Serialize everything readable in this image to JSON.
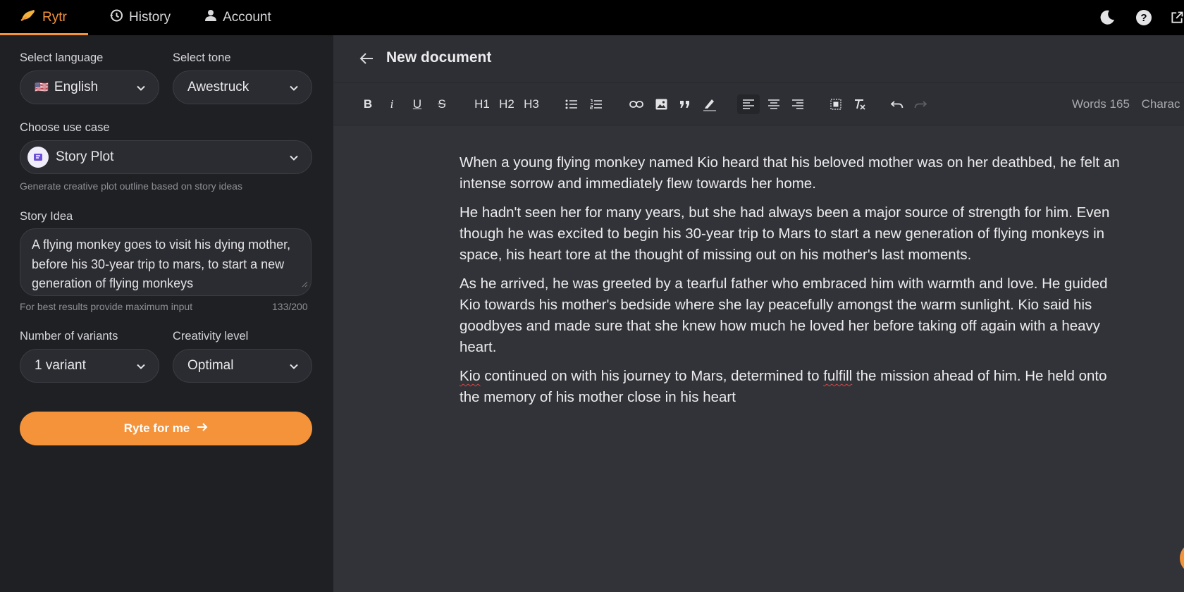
{
  "nav": {
    "brand": "Rytr",
    "tabs": [
      {
        "label": "History",
        "icon": "history-icon"
      },
      {
        "label": "Account",
        "icon": "account-icon"
      }
    ],
    "right_icons": [
      "moon-icon",
      "help-icon",
      "external-link-icon"
    ]
  },
  "sidebar": {
    "language": {
      "label": "Select language",
      "value": "English",
      "flag": "🇺🇸"
    },
    "tone": {
      "label": "Select tone",
      "value": "Awestruck"
    },
    "use_case": {
      "label": "Choose use case",
      "value": "Story Plot",
      "hint": "Generate creative plot outline based on story ideas"
    },
    "story_idea": {
      "label": "Story Idea",
      "value": "A flying monkey goes to visit his dying mother, before his 30-year trip to mars, to start a new generation of flying monkeys",
      "hint": "For best results provide maximum input",
      "count": "133/200"
    },
    "variants": {
      "label": "Number of variants",
      "value": "1 variant"
    },
    "creativity": {
      "label": "Creativity level",
      "value": "Optimal"
    },
    "button": "Ryte for me"
  },
  "document": {
    "title": "New document",
    "words": "Words 165",
    "characters": "Charac",
    "toolbar": {
      "bold": "B",
      "italic": "i",
      "underline": "U",
      "strike": "S",
      "h1": "H1",
      "h2": "H2",
      "h3": "H3"
    },
    "paragraphs": [
      "When a young flying monkey named Kio heard that his beloved mother was on her deathbed, he felt an intense sorrow and immediately flew towards her home.",
      "He hadn't seen her for many years, but she had always been a major source of strength for him. Even though he was excited to begin his 30-year trip to Mars to start a new generation of flying monkeys in space, his heart tore at the thought of missing out on his mother's last moments.",
      "As he arrived, he was greeted by a tearful father who embraced him with warmth and love. He guided Kio towards his mother's bedside where she lay peacefully amongst the warm sunlight. Kio said his goodbyes and made sure that she knew how much he loved her before taking off again with a heavy heart."
    ],
    "last_paragraph": {
      "w1": "Kio",
      "t1": " continued on with his journey to Mars, determined to ",
      "w2": "fulfill",
      "t2": " the mission ahead of him. He held onto the memory of his mother close in his heart"
    }
  },
  "colors": {
    "accent": "#f4933a",
    "sidebar": "#1f2024",
    "editor": "#323338"
  }
}
